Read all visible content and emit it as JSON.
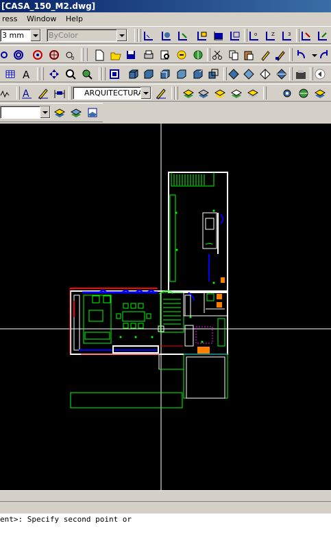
{
  "window": {
    "title": "[CASA_150_M2.dwg]"
  },
  "menu": {
    "items": [
      "ress",
      "Window",
      "Help"
    ]
  },
  "properties_toolbar": {
    "lineweight_value": "3 mm",
    "color_value": "ByColor"
  },
  "text_toolbar": {
    "textstyle_value": "ARQUITECTURA"
  },
  "command_line": {
    "prompt": "ent>: Specify second point or"
  },
  "colors": {
    "canvas": "#000000",
    "walls": "#ffffff",
    "green": "#00ff00",
    "blue": "#0000ff",
    "red": "#ff0000",
    "magenta": "#ff00ff",
    "orange": "#ff8000",
    "yellow": "#ffff00"
  }
}
